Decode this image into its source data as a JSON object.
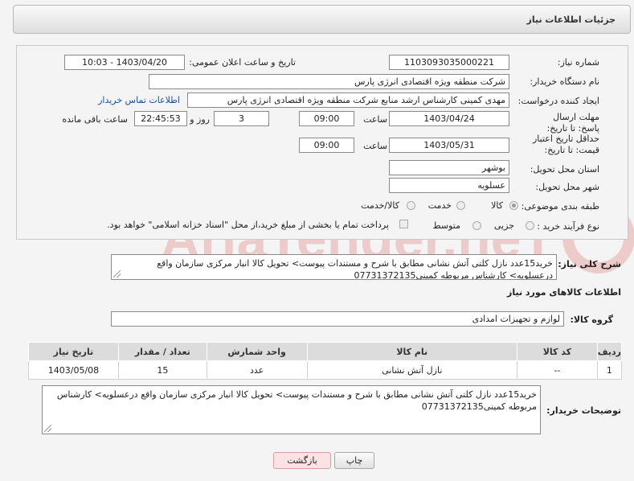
{
  "header": {
    "title": "جزئیات اطلاعات نیاز"
  },
  "form": {
    "need_number_label": "شماره نیاز:",
    "need_number": "1103093035000221",
    "announce_label": "تاریخ و ساعت اعلان عمومی:",
    "announce_value": "1403/04/20 - 10:03",
    "buyer_org_label": "نام دستگاه خریدار:",
    "buyer_org": "شرکت منطقه ویژه اقتصادی انرژی پارس",
    "requester_label": "ایجاد کننده درخواست:",
    "requester": "مهدی کمینی کارشناس ارشد منابع شرکت منطقه ویژه اقتصادی انرژی پارس",
    "contact_link": "اطلاعات تماس خریدار",
    "deadline_label": "مهلت ارسال پاسخ: تا تاریخ:",
    "deadline_date": "1403/04/24",
    "time_label": "ساعت",
    "deadline_time": "09:00",
    "days_count": "3",
    "days_label": "روز و",
    "remaining_time": "22:45:53",
    "remaining_label": "ساعت باقی مانده",
    "validity_label": "حداقل تاریخ اعتبار قیمت: تا تاریخ:",
    "validity_date": "1403/05/31",
    "validity_time": "09:00",
    "province_label": "استان محل تحویل:",
    "province": "بوشهر",
    "city_label": "شهر محل تحویل:",
    "city": "عسلویه",
    "category_label": "طبقه بندی موضوعی:",
    "category_options": [
      "کالا",
      "خدمت",
      "کالا/خدمت"
    ],
    "process_label": "نوع فرآیند خرید :",
    "process_options": [
      "جزیی",
      "متوسط"
    ],
    "payment_note": "پرداخت تمام یا بخشی از مبلغ خرید،از محل \"اسناد خزانه اسلامی\" خواهد بود."
  },
  "description": {
    "label": "شرح کلی نیاز:",
    "text": "خرید15عدد نازل کلتی آتش نشانی  مطابق با شرح  و مستندات پیوست> تحویل کالا انبار مرکزی سازمان  واقع درعسلویه> کارشناس مربوطه کمینی07731372135"
  },
  "goods": {
    "section_title": "اطلاعات کالاهای مورد نیاز",
    "group_label": "گروه کالا:",
    "group_value": "لوازم و تجهیزات امدادی",
    "columns": [
      "ردیف",
      "کد کالا",
      "نام کالا",
      "واحد شمارش",
      "تعداد / مقدار",
      "تاریخ نیاز"
    ],
    "rows": [
      {
        "index": "1",
        "code": "--",
        "name": "نازل آتش نشانی",
        "unit": "عدد",
        "qty": "15",
        "date": "1403/05/08"
      }
    ]
  },
  "buyer_notes": {
    "label": "توضیحات خریدار:",
    "text": "خرید15عدد نازل کلتی آتش نشانی  مطابق با شرح  و مستندات پیوست> تحویل کالا انبار مرکزی سازمان  واقع درعسلویه> کارشناس مربوطه کمینی07731372135"
  },
  "buttons": {
    "print": "چاپ",
    "back": "بازگشت"
  },
  "watermark": {
    "text": "AriaTender.neT"
  }
}
